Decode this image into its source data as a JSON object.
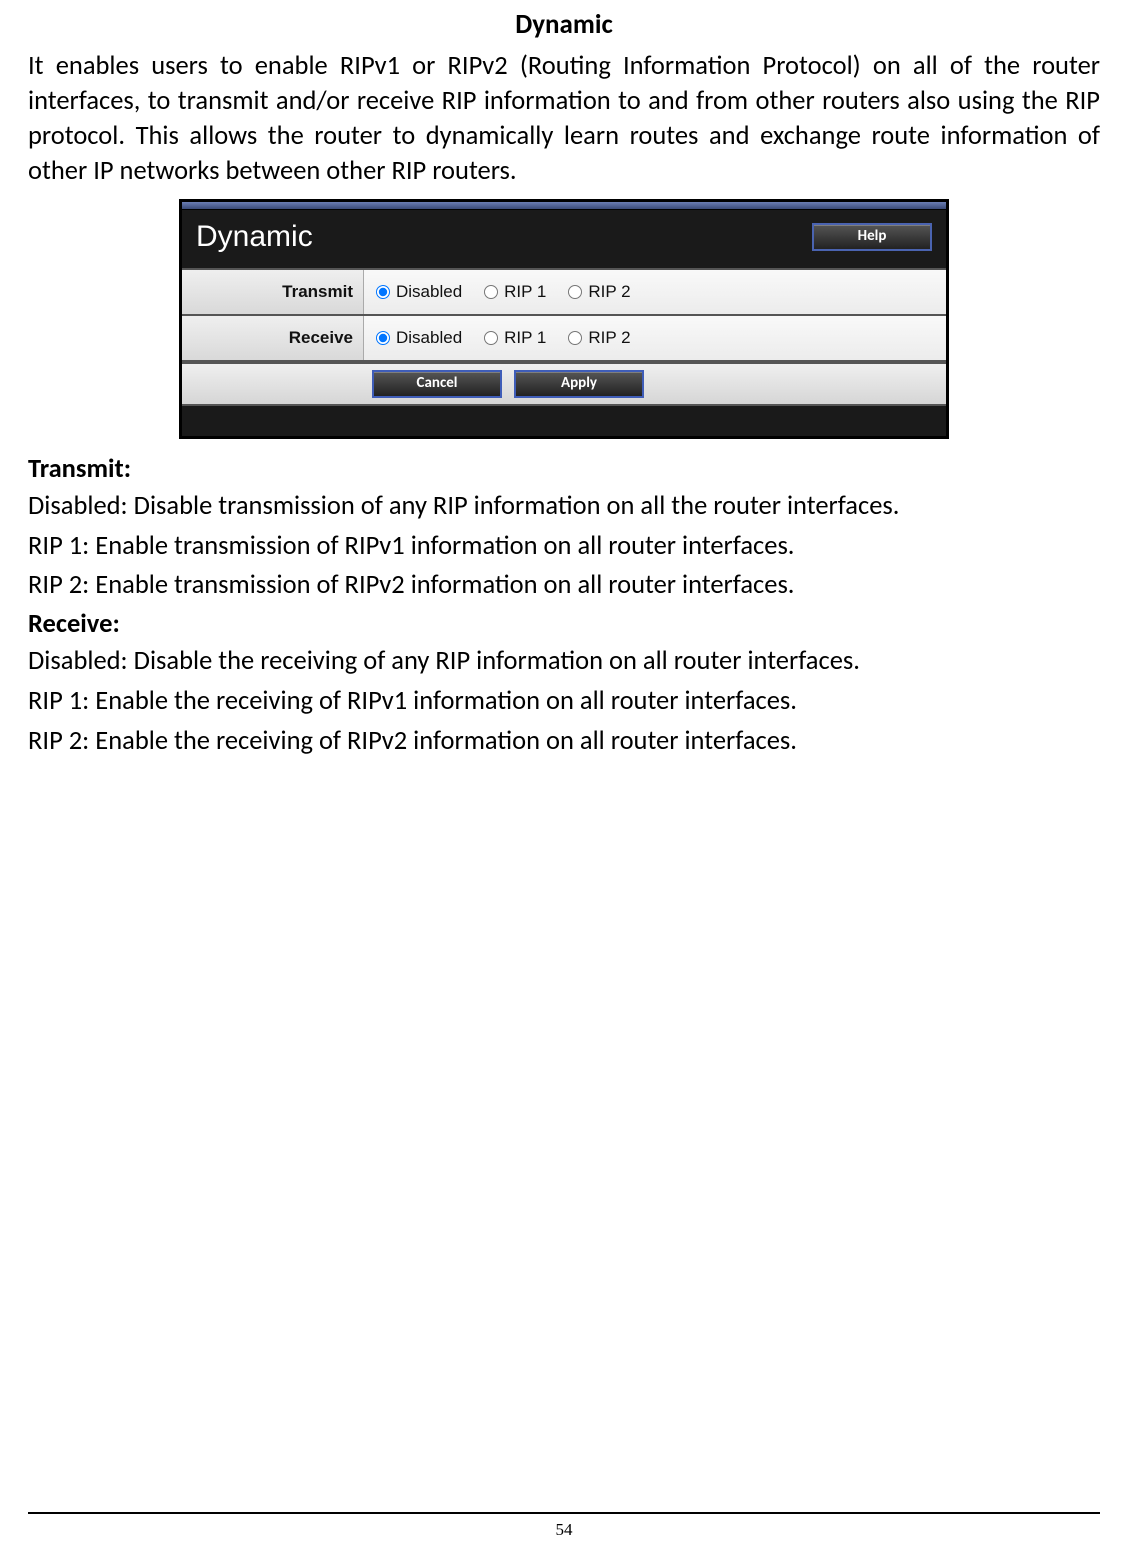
{
  "title": "Dynamic",
  "intro": "It enables users to enable RIPv1 or RIPv2 (Routing Information Protocol) on all of the router interfaces, to transmit and/or receive RIP information to and from other routers also using the RIP protocol. This allows the router to dynamically learn routes and exchange route information of other IP networks between other RIP routers.",
  "panel": {
    "title": "Dynamic",
    "help": "Help",
    "rows": {
      "transmit": {
        "label": "Transmit",
        "options": [
          "Disabled",
          "RIP 1",
          "RIP 2"
        ],
        "selected": 0
      },
      "receive": {
        "label": "Receive",
        "options": [
          "Disabled",
          "RIP 1",
          "RIP 2"
        ],
        "selected": 0
      }
    },
    "buttons": {
      "cancel": "Cancel",
      "apply": "Apply"
    }
  },
  "sections": {
    "transmit_label": "Transmit:",
    "transmit_lines": [
      "Disabled: Disable transmission of any RIP information on all the router interfaces.",
      "RIP 1: Enable transmission of RIPv1 information on all router interfaces.",
      "RIP 2: Enable transmission of RIPv2 information on all router interfaces."
    ],
    "receive_label": "Receive:",
    "receive_lines": [
      "Disabled: Disable the receiving of any RIP information on all router interfaces.",
      "RIP 1: Enable the receiving of RIPv1 information on all router interfaces.",
      "RIP 2: Enable the receiving of RIPv2 information on all router interfaces."
    ]
  },
  "page_number": "54"
}
